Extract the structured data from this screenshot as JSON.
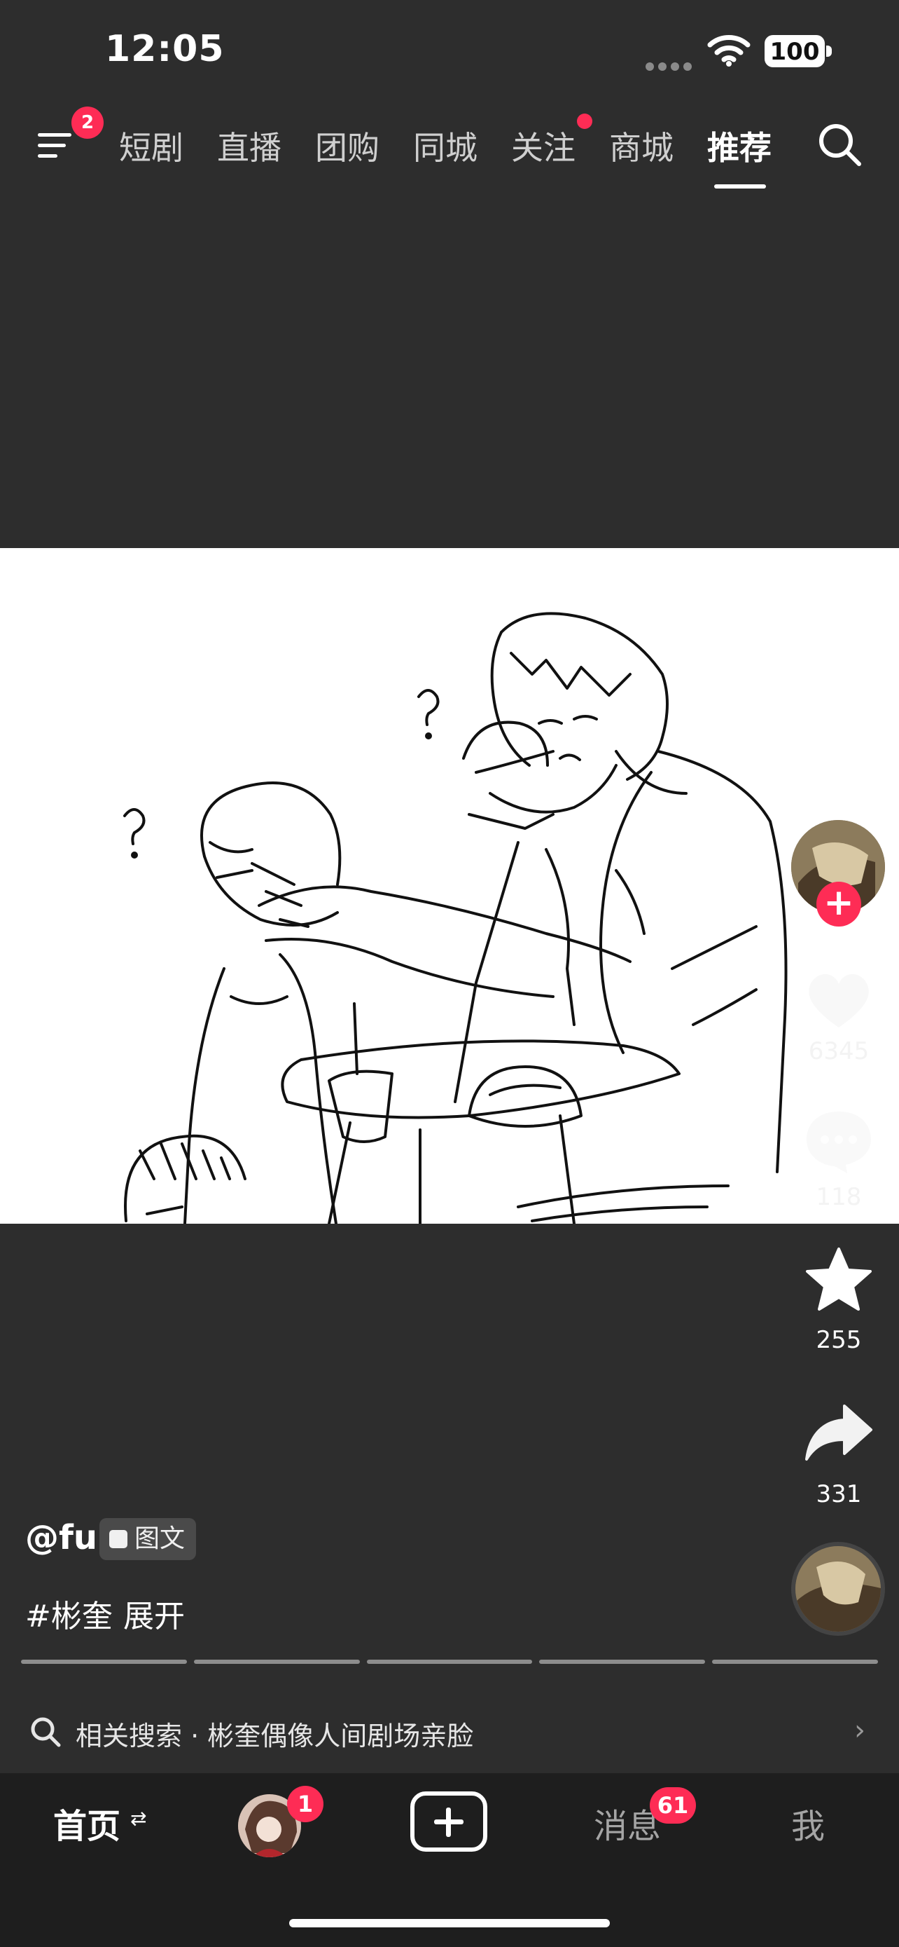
{
  "status_bar": {
    "time": "12:05",
    "battery": "100"
  },
  "top_nav": {
    "menu_badge": "2",
    "tabs": [
      "短剧",
      "直播",
      "团购",
      "同城",
      "关注",
      "商城",
      "推荐"
    ],
    "active_tab": "推荐"
  },
  "actions": {
    "like_count": "6345",
    "comment_count": "118",
    "favorite_count": "255",
    "share_count": "331"
  },
  "post": {
    "author": "@fu",
    "type_tag": "图文",
    "hashtag": "#彬奎",
    "expand": "展开",
    "image_pages": 5
  },
  "related_search": {
    "label": "相关搜索 · 彬奎偶像人间剧场亲脸"
  },
  "bottom_tabs": {
    "home": "首页",
    "home_swap": "⇄",
    "friend_badge": "1",
    "messages": "消息",
    "messages_badge": "61",
    "me": "我"
  },
  "colors": {
    "accent": "#fe2c55",
    "background": "#2d2d2d",
    "tabbar": "#1e1e1e"
  }
}
